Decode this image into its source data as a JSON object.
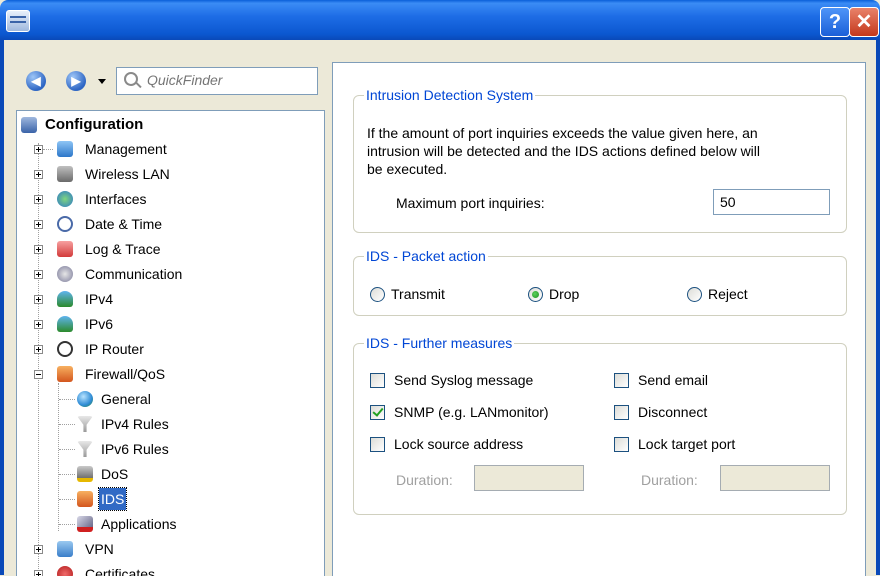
{
  "window": {
    "help_label": "?",
    "close_label": "✕"
  },
  "toolbar": {
    "quickfinder_placeholder": "QuickFinder",
    "back_icon": "back-arrow-icon",
    "forward_icon": "forward-arrow-icon"
  },
  "tree": {
    "root": "Configuration",
    "items": [
      {
        "label": "Management",
        "icon": "management-icon"
      },
      {
        "label": "Wireless LAN",
        "icon": "wireless-lan-icon"
      },
      {
        "label": "Interfaces",
        "icon": "interfaces-icon"
      },
      {
        "label": "Date & Time",
        "icon": "clock-icon"
      },
      {
        "label": "Log & Trace",
        "icon": "log-icon"
      },
      {
        "label": "Communication",
        "icon": "communication-icon"
      },
      {
        "label": "IPv4",
        "icon": "ipv4-icon"
      },
      {
        "label": "IPv6",
        "icon": "ipv6-icon"
      },
      {
        "label": "IP Router",
        "icon": "router-icon"
      },
      {
        "label": "Firewall/QoS",
        "icon": "firewall-icon"
      },
      {
        "label": "VPN",
        "icon": "vpn-icon"
      },
      {
        "label": "Certificates",
        "icon": "certificates-icon"
      }
    ],
    "firewall_children": [
      {
        "label": "General",
        "icon": "globe-icon"
      },
      {
        "label": "IPv4 Rules",
        "icon": "filter-icon"
      },
      {
        "label": "IPv6 Rules",
        "icon": "filter-icon"
      },
      {
        "label": "DoS",
        "icon": "dos-icon"
      },
      {
        "label": "IDS",
        "icon": "ids-icon"
      },
      {
        "label": "Applications",
        "icon": "applications-icon"
      }
    ]
  },
  "ids": {
    "title": "Intrusion Detection System",
    "desc1": "If the amount of port inquiries exceeds the value given here, an",
    "desc2": "intrusion will be detected and the IDS actions defined below will",
    "desc3": "be executed.",
    "max_label": "Maximum port inquiries:",
    "max_value": "50"
  },
  "packet_action": {
    "title": "IDS - Packet action",
    "transmit": "Transmit",
    "drop": "Drop",
    "reject": "Reject",
    "selected": "Drop"
  },
  "measures": {
    "title": "IDS - Further measures",
    "syslog": "Send Syslog message",
    "snmp": "SNMP (e.g. LANmonitor)",
    "lock_source": "Lock source address",
    "email": "Send email",
    "disconnect": "Disconnect",
    "lock_target": "Lock target port",
    "duration_label": "Duration:",
    "duration_label2": "Duration:"
  },
  "colors": {
    "titlebar": "#0a5fd8",
    "group_title": "#0046d5",
    "selection": "#316ac5"
  }
}
